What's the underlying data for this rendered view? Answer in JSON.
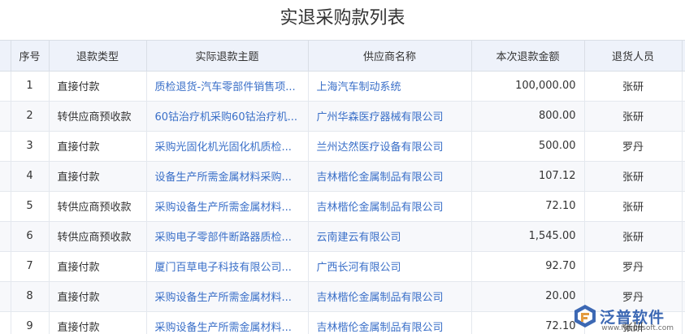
{
  "title": "实退采购款列表",
  "columns": [
    "序号",
    "退款类型",
    "实际退款主题",
    "供应商名称",
    "本次退款金额",
    "退货人员"
  ],
  "rows": [
    {
      "idx": "1",
      "type": "直接付款",
      "subject": "质检退货-汽车零部件销售项...",
      "supplier": "上海汽车制动系统",
      "amount": "100,000.00",
      "person": "张研"
    },
    {
      "idx": "2",
      "type": "转供应商预收款",
      "subject": "60钴治疗机采购60钴治疗机...",
      "supplier": "广州华森医疗器械有限公司",
      "amount": "800.00",
      "person": "张研"
    },
    {
      "idx": "3",
      "type": "直接付款",
      "subject": "采购光固化机光固化机质检...",
      "supplier": "兰州达然医疗设备有限公司",
      "amount": "500.00",
      "person": "罗丹"
    },
    {
      "idx": "4",
      "type": "直接付款",
      "subject": "设备生产所需金属材料采购...",
      "supplier": "吉林楷伦金属制品有限公司",
      "amount": "107.12",
      "person": "张研"
    },
    {
      "idx": "5",
      "type": "转供应商预收款",
      "subject": "采购设备生产所需金属材料...",
      "supplier": "吉林楷伦金属制品有限公司",
      "amount": "72.10",
      "person": "张研"
    },
    {
      "idx": "6",
      "type": "转供应商预收款",
      "subject": "采购电子零部件断路器质检...",
      "supplier": "云南建云有限公司",
      "amount": "1,545.00",
      "person": "张研"
    },
    {
      "idx": "7",
      "type": "直接付款",
      "subject": "厦门百草电子科技有限公司...",
      "supplier": "广西长河有限公司",
      "amount": "92.70",
      "person": "罗丹"
    },
    {
      "idx": "8",
      "type": "直接付款",
      "subject": "采购设备生产所需金属材料...",
      "supplier": "吉林楷伦金属制品有限公司",
      "amount": "20.00",
      "person": "罗丹"
    },
    {
      "idx": "9",
      "type": "直接付款",
      "subject": "采购设备生产所需金属材料...",
      "supplier": "吉林楷伦金属制品有限公司",
      "amount": "72.10",
      "person": "张研"
    }
  ],
  "watermark": {
    "brand": "泛普软件",
    "url": "www.fanpusoft.com",
    "logo_icon": "fanpu-logo-icon"
  },
  "colors": {
    "header_bg": "#eef2fa",
    "link": "#3a6fc8",
    "border": "#d9dee6",
    "brand": "#1c4fa8"
  }
}
